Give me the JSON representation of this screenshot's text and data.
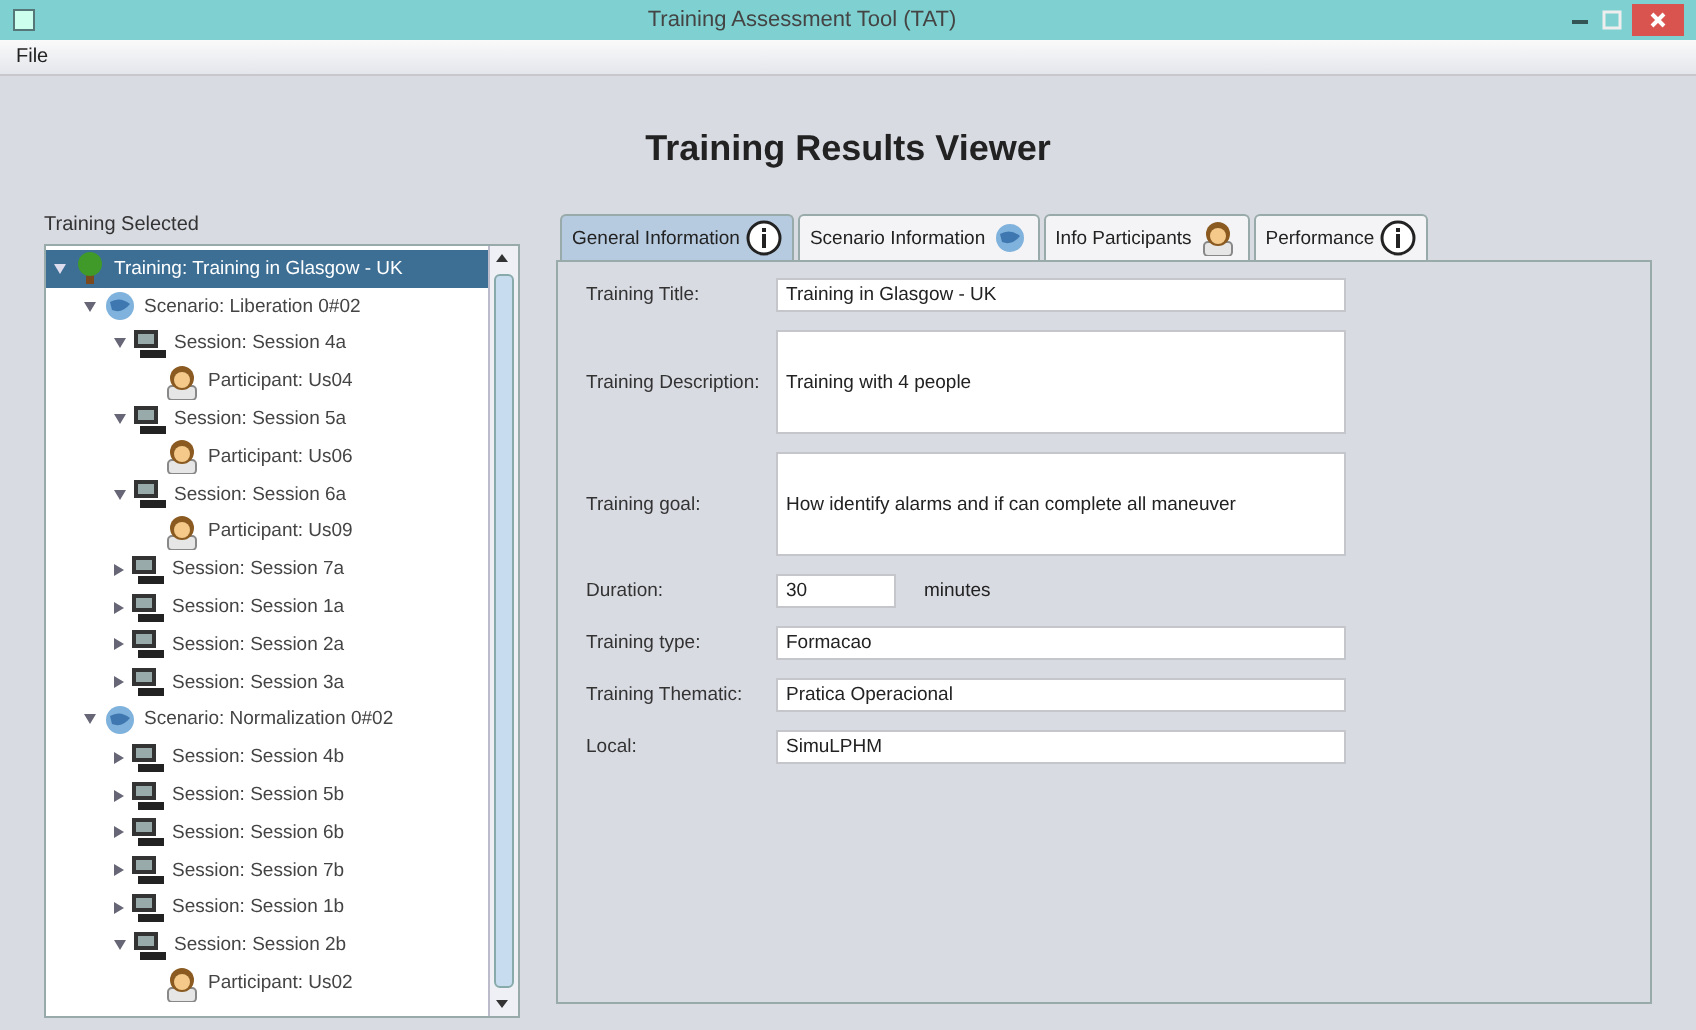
{
  "window": {
    "title": "Training Assessment Tool (TAT)"
  },
  "menu": [
    "File"
  ],
  "heading": "Training Results Viewer",
  "tree_panel": {
    "label": "Training Selected",
    "tree": [
      {
        "kind": "training",
        "label": "Training: Training in Glasgow - UK",
        "selected": true,
        "expanded": true,
        "children": [
          {
            "kind": "scenario",
            "label": "Scenario: Liberation 0#02",
            "selected": false,
            "expanded": true,
            "children": [
              {
                "kind": "session",
                "label": "Session: Session 4a",
                "selected": false,
                "expanded": true,
                "children": [
                  {
                    "kind": "participant",
                    "label": "Participant: Us04",
                    "selected": false
                  }
                ]
              },
              {
                "kind": "session",
                "label": "Session: Session 5a",
                "selected": false,
                "expanded": true,
                "children": [
                  {
                    "kind": "participant",
                    "label": "Participant: Us06",
                    "selected": false
                  }
                ]
              },
              {
                "kind": "session",
                "label": "Session: Session 6a",
                "selected": false,
                "expanded": true,
                "children": [
                  {
                    "kind": "participant",
                    "label": "Participant: Us09",
                    "selected": false
                  }
                ]
              },
              {
                "kind": "session",
                "label": "Session: Session 7a",
                "selected": false,
                "expanded": false
              },
              {
                "kind": "session",
                "label": "Session: Session 1a",
                "selected": false,
                "expanded": false
              },
              {
                "kind": "session",
                "label": "Session: Session 2a",
                "selected": false,
                "expanded": false
              },
              {
                "kind": "session",
                "label": "Session: Session 3a",
                "selected": false,
                "expanded": false
              }
            ]
          },
          {
            "kind": "scenario",
            "label": "Scenario: Normalization 0#02",
            "selected": false,
            "expanded": true,
            "children": [
              {
                "kind": "session",
                "label": "Session: Session 4b",
                "selected": false,
                "expanded": false
              },
              {
                "kind": "session",
                "label": "Session: Session 5b",
                "selected": false,
                "expanded": false
              },
              {
                "kind": "session",
                "label": "Session: Session 6b",
                "selected": false,
                "expanded": false
              },
              {
                "kind": "session",
                "label": "Session: Session 7b",
                "selected": false,
                "expanded": false
              },
              {
                "kind": "session",
                "label": "Session: Session 1b",
                "selected": false,
                "expanded": false
              },
              {
                "kind": "session",
                "label": "Session: Session 2b",
                "selected": false,
                "expanded": true,
                "children": [
                  {
                    "kind": "participant",
                    "label": "Participant: Us02",
                    "selected": false
                  }
                ]
              }
            ]
          }
        ]
      }
    ]
  },
  "tabs": [
    {
      "label": "General Information",
      "kind": "info",
      "selected": true
    },
    {
      "label": "Scenario Information",
      "kind": "scenario",
      "selected": false
    },
    {
      "label": "Info Participants",
      "kind": "participant",
      "selected": false
    },
    {
      "label": "Performance",
      "kind": "info",
      "selected": false
    }
  ],
  "form": [
    {
      "kind": "text",
      "label": "Training Title:",
      "value": "Training in Glasgow - UK"
    },
    {
      "kind": "area",
      "label": "Training Description:",
      "value": "Training with 4 people"
    },
    {
      "kind": "area",
      "label": "Training goal:",
      "value": "How identify alarms and if can complete all maneuver"
    },
    {
      "kind": "spinner",
      "label": "Duration:",
      "value": "30",
      "unit": "minutes"
    },
    {
      "kind": "text",
      "label": "Training type:",
      "value": "Formacao"
    },
    {
      "kind": "text",
      "label": "Training Thematic:",
      "value": "Pratica Operacional"
    },
    {
      "kind": "text",
      "label": "Local:",
      "value": "SimuLPHM"
    }
  ]
}
